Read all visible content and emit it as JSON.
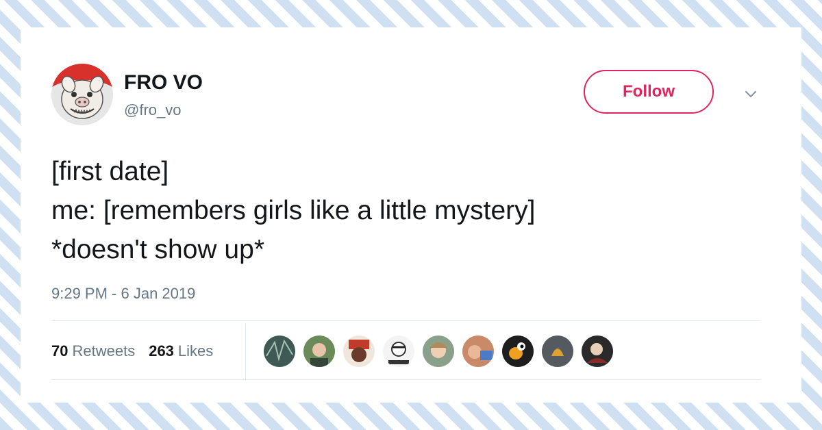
{
  "author": {
    "name": "FRO VO",
    "handle": "@fro_vo"
  },
  "follow_button_label": "Follow",
  "tweet": {
    "lines": [
      "[first date]",
      "me: [remembers girls like a little mystery]",
      "*doesn't show up*"
    ],
    "timestamp": "9:29 PM - 6 Jan 2019"
  },
  "stats": {
    "retweets_count": "70",
    "retweets_label": "Retweets",
    "likes_count": "263",
    "likes_label": "Likes"
  },
  "likers": [
    {
      "icon": "liker-avatar-1",
      "color": "#3f5a55"
    },
    {
      "icon": "liker-avatar-2",
      "color": "#6a8a5a"
    },
    {
      "icon": "liker-avatar-3",
      "color": "#7a3a2a"
    },
    {
      "icon": "liker-avatar-4",
      "color": "#d8d8d8"
    },
    {
      "icon": "liker-avatar-5",
      "color": "#8aa08a"
    },
    {
      "icon": "liker-avatar-6",
      "color": "#c98a6a"
    },
    {
      "icon": "liker-avatar-7",
      "color": "#1e1e1e"
    },
    {
      "icon": "liker-avatar-8",
      "color": "#555a60"
    },
    {
      "icon": "liker-avatar-9",
      "color": "#2a2a2a"
    }
  ],
  "colors": {
    "accent": "#e0245e",
    "text": "#14171a",
    "muted": "#657786",
    "stripe": "#cfe0f3"
  }
}
